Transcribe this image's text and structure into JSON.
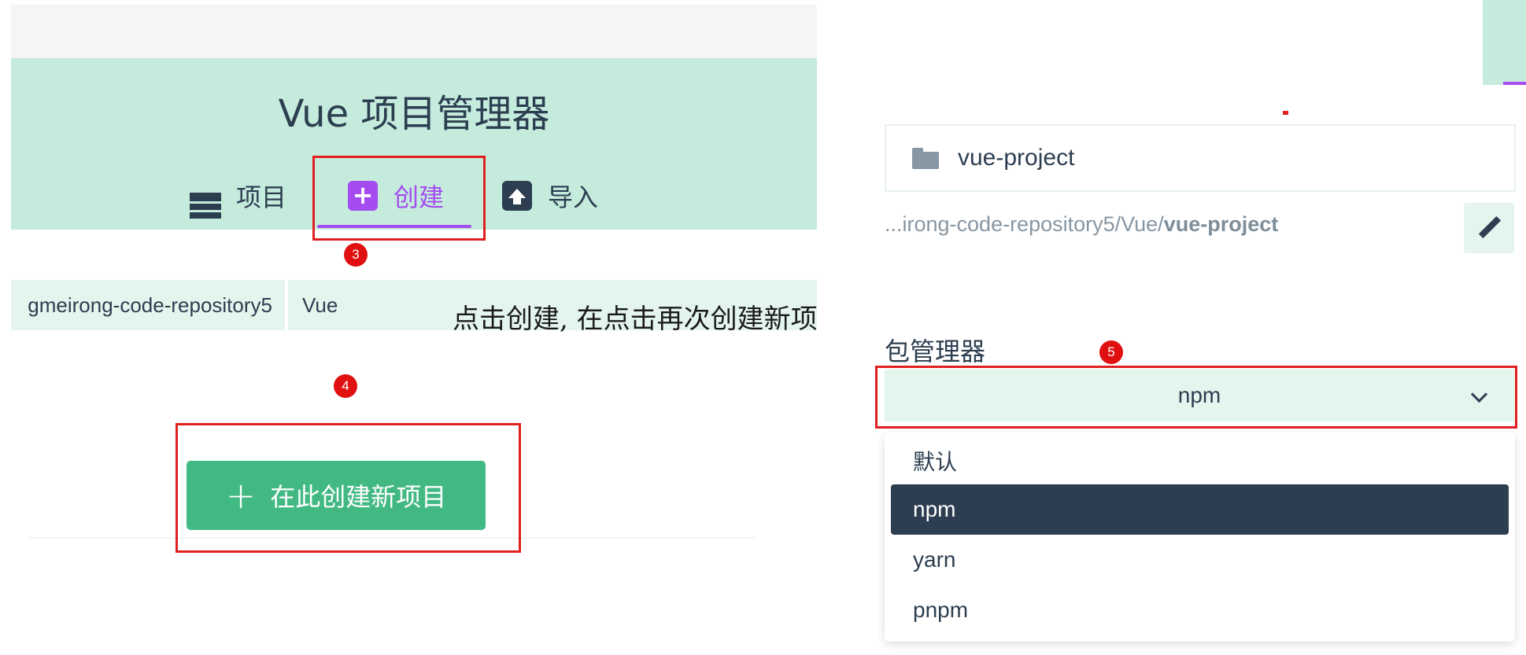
{
  "app": {
    "title": "Vue 项目管理器"
  },
  "tabs": [
    {
      "label": "项目",
      "icon": "list-icon"
    },
    {
      "label": "创建",
      "icon": "plus-square-icon",
      "active": true
    },
    {
      "label": "导入",
      "icon": "import-icon"
    }
  ],
  "breadcrumb": {
    "segments": [
      "gmeirong-code-repository5",
      "Vue"
    ]
  },
  "annotations": {
    "step3": "3",
    "step4": "4",
    "step5": "5",
    "hint": "点击创建, 在点击再次创建新项"
  },
  "create_button": {
    "label": "在此创建新项目",
    "icon": "plus-icon"
  },
  "project": {
    "folder_name": "vue-project",
    "path_prefix": "...irong-code-repository5/Vue/",
    "path_name": "vue-project"
  },
  "package_manager": {
    "label": "包管理器",
    "selected": "npm",
    "options": [
      "默认",
      "npm",
      "yarn",
      "pnpm"
    ]
  },
  "colors": {
    "accent": "#42b983",
    "active_tab": "#a44cf0",
    "header_bg": "#c5ebdd",
    "annotation": "#e02020",
    "selected_option": "#2c3e50"
  }
}
